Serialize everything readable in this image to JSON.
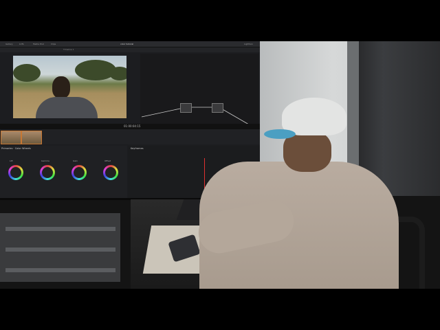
{
  "resolve_ui": {
    "menu_items": [
      "Gallery",
      "LUTs",
      "Media Pool",
      "Clips"
    ],
    "project_title": "color tutorial",
    "right_menu_items": [
      "Lightbox"
    ],
    "timeline_name": "Timeline 1",
    "viewer_timecode": "01:00:04:15",
    "panel_primaries": "Primaries · Color Wheels",
    "panel_keyframes": "Keyframes",
    "wheel_labels": [
      "Lift",
      "Gamma",
      "Gain",
      "Offset"
    ]
  },
  "colors": {
    "accent_orange": "#c87732",
    "playhead_red": "#e03030",
    "cap_brim_blue": "#4b9fc2"
  }
}
